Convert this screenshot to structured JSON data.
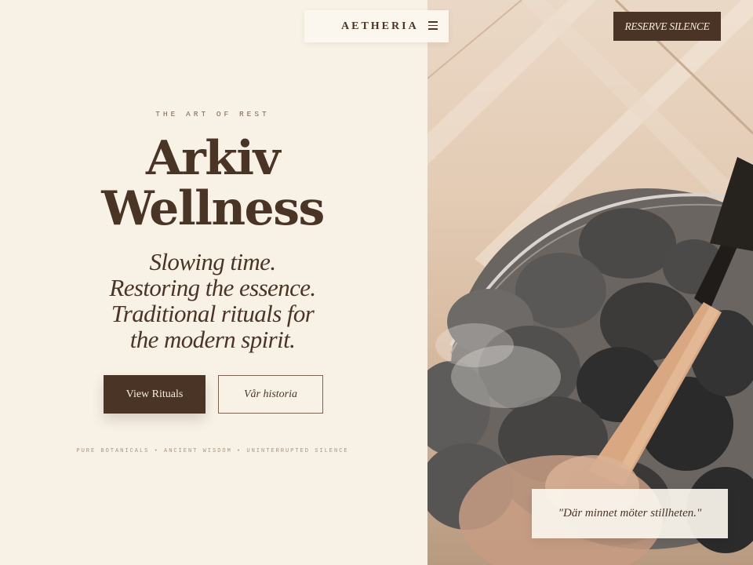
{
  "nav": {
    "brand": "AETHERIA",
    "menu_icon": "hamburger-menu-icon",
    "reserve_label": "RESERVE SILENCE"
  },
  "hero": {
    "eyebrow": "THE ART OF REST",
    "title_lines": [
      "Arkiv",
      "Wellness"
    ],
    "tagline_lines": [
      "Slowing time.",
      "Restoring the essence.",
      "Traditional rituals for",
      "the modern spirit."
    ],
    "primary_button": "View Rituals",
    "secondary_button": "Vår historia",
    "footnote": "PURE BOTANICALS • ANCIENT WISDOM • UNINTERRUPTED SILENCE"
  },
  "quote": {
    "text": "\"Där minnet möter stillheten.\""
  },
  "colors": {
    "background": "#f8f2e6",
    "brand_brown": "#4a3426",
    "muted_text": "#a4927f"
  }
}
